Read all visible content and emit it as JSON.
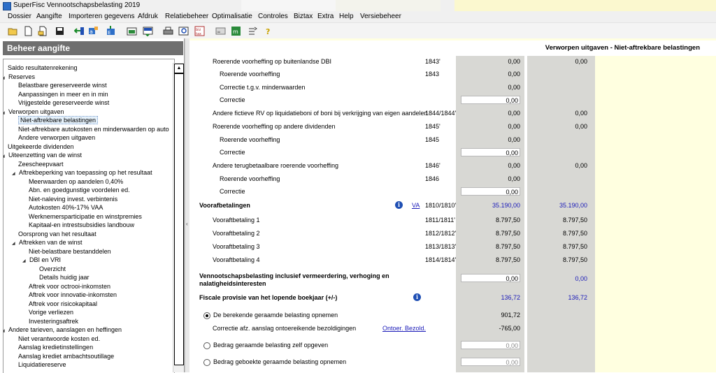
{
  "window": {
    "title": "SuperFisc Vennootschapsbelasting 2019"
  },
  "menu": [
    "Dossier",
    "Aangifte",
    "Importeren gegevens",
    "Afdruk",
    "Relatiebeheer",
    "Optimalisatie",
    "Controles",
    "Biztax",
    "Extra",
    "Help",
    "Versiebeheer"
  ],
  "toolbar_icons": [
    "open-folder-icon",
    "new-document-icon",
    "open-document-icon",
    "save-icon",
    "import-icon",
    "data-transfer-icon",
    "export-icon",
    "report-icon",
    "print-icon",
    "preview-icon",
    "biztax-icon",
    "link-icon",
    "spreadsheet-icon",
    "compare-icon",
    "help-icon"
  ],
  "sidebar": {
    "title": "Beheer aangifte",
    "items": [
      {
        "label": "Saldo resultatenrekening",
        "level": 0,
        "toggle": ""
      },
      {
        "label": "Reserves",
        "level": 0,
        "toggle": "down"
      },
      {
        "label": "Belastbare gereserveerde winst",
        "level": 1,
        "toggle": ""
      },
      {
        "label": "Aanpassingen in meer en in min",
        "level": 1,
        "toggle": ""
      },
      {
        "label": "Vrijgestelde gereserveerde winst",
        "level": 1,
        "toggle": ""
      },
      {
        "label": "Verworpen uitgaven",
        "level": 0,
        "toggle": "down"
      },
      {
        "label": "Niet-aftrekbare belastingen",
        "level": 1,
        "toggle": "",
        "selected": true
      },
      {
        "label": "Niet-aftrekbare autokosten en minderwaarden op auto",
        "level": 1,
        "toggle": ""
      },
      {
        "label": "Andere verworpen uitgaven",
        "level": 1,
        "toggle": ""
      },
      {
        "label": "Uitgekeerde dividenden",
        "level": 0,
        "toggle": ""
      },
      {
        "label": "Uiteenzetting van de winst",
        "level": 0,
        "toggle": "down"
      },
      {
        "label": "Zeescheepvaart",
        "level": 1,
        "toggle": ""
      },
      {
        "label": "Aftrekbeperking van toepassing op het resultaat",
        "level": 1,
        "toggle": "down"
      },
      {
        "label": "Meerwaarden op aandelen 0,40%",
        "level": 2,
        "toggle": ""
      },
      {
        "label": "Abn. en goedgunstige voordelen ed.",
        "level": 2,
        "toggle": ""
      },
      {
        "label": "Niet-naleving invest. verbintenis",
        "level": 2,
        "toggle": ""
      },
      {
        "label": "Autokosten 40%-17% VAA",
        "level": 2,
        "toggle": ""
      },
      {
        "label": "Werknemersparticipatie en winstpremies",
        "level": 2,
        "toggle": ""
      },
      {
        "label": "Kapitaal-en intrestsubsidies landbouw",
        "level": 2,
        "toggle": ""
      },
      {
        "label": "Oorsprong van het resultaat",
        "level": 1,
        "toggle": ""
      },
      {
        "label": "Aftrekken van de winst",
        "level": 1,
        "toggle": "down"
      },
      {
        "label": "Niet-belastbare bestanddelen",
        "level": 2,
        "toggle": ""
      },
      {
        "label": "DBI en VRI",
        "level": 2,
        "toggle": "down"
      },
      {
        "label": "Overzicht",
        "level": 3,
        "toggle": ""
      },
      {
        "label": "Details huidig jaar",
        "level": 3,
        "toggle": ""
      },
      {
        "label": "Aftrek voor octrooi-inkomsten",
        "level": 2,
        "toggle": ""
      },
      {
        "label": "Aftrek voor innovatie-inkomsten",
        "level": 2,
        "toggle": ""
      },
      {
        "label": "Aftrek voor risicokapitaal",
        "level": 2,
        "toggle": ""
      },
      {
        "label": "Vorige verliezen",
        "level": 2,
        "toggle": ""
      },
      {
        "label": "Investeringsaftrek",
        "level": 2,
        "toggle": ""
      },
      {
        "label": "Andere tarieven, aanslagen en heffingen",
        "level": 0,
        "toggle": "down"
      },
      {
        "label": "Niet verantwoorde kosten ed.",
        "level": 1,
        "toggle": ""
      },
      {
        "label": "Aanslag kredietinstellingen",
        "level": 1,
        "toggle": ""
      },
      {
        "label": "Aanslag krediet ambachtsoutillage",
        "level": 1,
        "toggle": ""
      },
      {
        "label": "Liquidatiereserve",
        "level": 1,
        "toggle": ""
      }
    ]
  },
  "page": {
    "title": "Verworpen uitgaven - Niet-aftrekbare belastingen"
  },
  "rows": [
    {
      "label": "Roerende voorheffing op buitenlandse DBI",
      "indent": 1,
      "code": "1843'",
      "a": "0,00",
      "b": "0,00"
    },
    {
      "label": "Roerende voorheffing",
      "indent": 2,
      "code": "1843",
      "a": "0,00"
    },
    {
      "label": "Correctie t.g.v. minderwaarden",
      "indent": 2,
      "a": "0,00"
    },
    {
      "label": "Correctie",
      "indent": 2,
      "input": "0,00"
    },
    {
      "label": "Andere fictieve RV op liquidatieboni of boni bij verkrijging van eigen aandelen",
      "indent": 1,
      "code": "1844/1844'",
      "a": "0,00",
      "b": "0,00"
    },
    {
      "label": "Roerende voorheffing op andere dividenden",
      "indent": 1,
      "code": "1845'",
      "a": "0,00",
      "b": "0,00"
    },
    {
      "label": "Roerende voorheffing",
      "indent": 2,
      "code": "1845",
      "a": "0,00"
    },
    {
      "label": "Correctie",
      "indent": 2,
      "input": "0,00"
    },
    {
      "label": "Andere terugbetaalbare roerende voorheffing",
      "indent": 1,
      "code": "1846'",
      "a": "0,00",
      "b": "0,00"
    },
    {
      "label": "Roerende voorheffing",
      "indent": 2,
      "code": "1846",
      "a": "0,00"
    },
    {
      "label": "Correctie",
      "indent": 2,
      "input": "0,00"
    },
    {
      "label": "Voorafbetalingen",
      "indent": 0,
      "bold": true,
      "info": true,
      "link": "VA",
      "code": "1810/1810'",
      "a": "35.190,00",
      "b": "35.190,00",
      "blue": true
    },
    {
      "label": "Vooraftbetaling 1",
      "indent": 1,
      "code": "1811/1811'",
      "a": "8.797,50",
      "b": "8.797,50"
    },
    {
      "label": "Vooraftbetaling 2",
      "indent": 1,
      "code": "1812/1812'",
      "a": "8.797,50",
      "b": "8.797,50"
    },
    {
      "label": "Vooraftbetaling 3",
      "indent": 1,
      "code": "1813/1813'",
      "a": "8.797,50",
      "b": "8.797,50"
    },
    {
      "label": "Vooraftbetaling 4",
      "indent": 1,
      "code": "1814/1814'",
      "a": "8.797,50",
      "b": "8.797,50"
    }
  ],
  "vennoot": {
    "label": "Vennootschapsbelasting inclusief vermeerdering, verhoging en nalatigheidsinterest en",
    "line1": "Vennootschapsbelasting inclusief vermeerdering, verhoging en",
    "line2": "nalatigheidsinteresten",
    "input": "0,00",
    "b": "0,00"
  },
  "provisie": {
    "label": "Fiscale provisie van het lopende boekjaar (+/-)",
    "a": "136,72",
    "b": "136,72"
  },
  "options": [
    {
      "label": "De berekende geraamde belasting opnemen",
      "value": "901,72",
      "checked": true
    },
    {
      "label": "Correctie afz. aanslag ontoereikende bezoldigingen",
      "link": "Ontoer. Bezold.",
      "value": "-765,00"
    },
    {
      "label": "Bedrag geraamde belasting zelf opgeven",
      "input": "0,00"
    },
    {
      "label": "Bedrag geboekte geraamde belasting opnemen",
      "input": "0,00"
    }
  ]
}
